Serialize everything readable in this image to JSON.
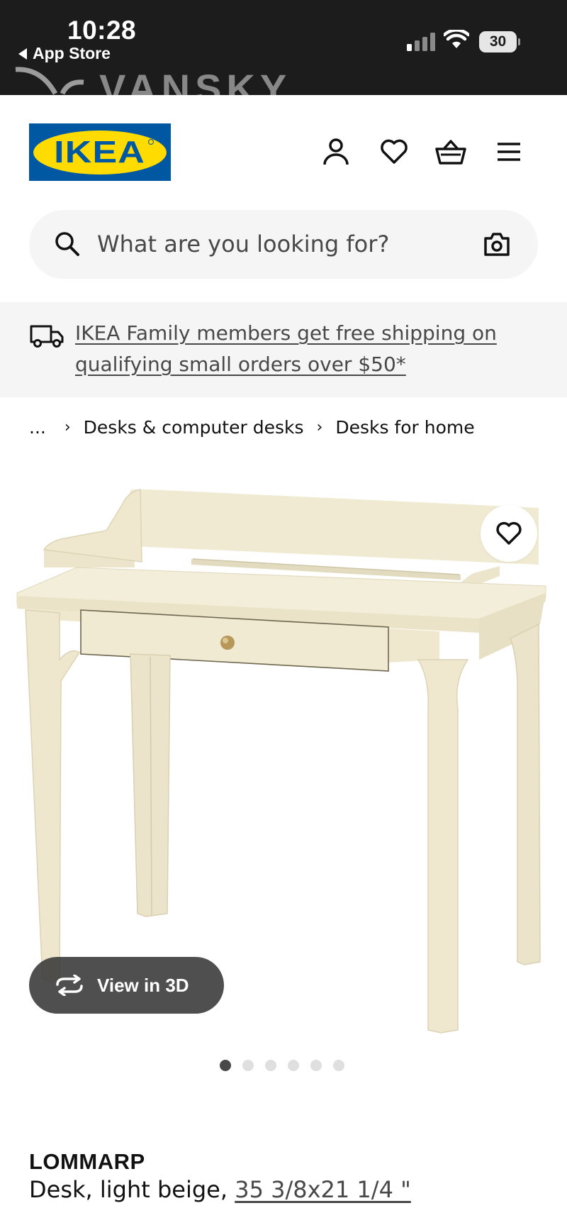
{
  "status_bar": {
    "time": "10:28",
    "back_label": "App Store",
    "battery": "30"
  },
  "watermark": "VANSKY",
  "brand": {
    "logo_text": "IKEA",
    "colors": {
      "blue": "#0058a3",
      "yellow": "#ffdb00"
    }
  },
  "header": {
    "icons": [
      "account-icon",
      "heart-icon",
      "shopping-basket-icon",
      "menu-icon"
    ]
  },
  "search": {
    "placeholder": "What are you looking for?"
  },
  "banner": {
    "text": "IKEA Family members get free shipping on qualifying small orders over $50*"
  },
  "breadcrumb": {
    "ellipsis": "...",
    "items": [
      "Desks & computer desks",
      "Desks for home"
    ]
  },
  "product": {
    "view_3d_label": "View in 3D",
    "image_count": 6,
    "active_image": 1,
    "name": "LOMMARP",
    "description": "Desk, light beige,",
    "size": "35 3/8x21 1/4 \""
  }
}
